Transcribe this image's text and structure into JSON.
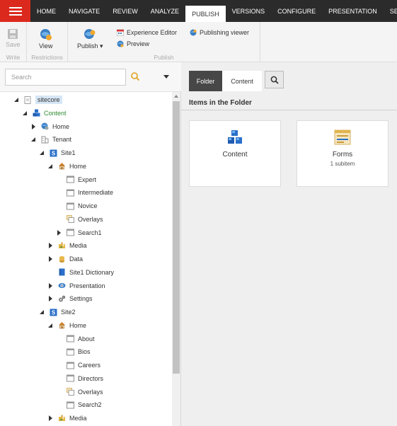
{
  "ribbon_tabs": [
    "HOME",
    "NAVIGATE",
    "REVIEW",
    "ANALYZE",
    "PUBLISH",
    "VERSIONS",
    "CONFIGURE",
    "PRESENTATION",
    "SECUR"
  ],
  "active_tab": "PUBLISH",
  "ribbon": {
    "write": {
      "group_label": "Write",
      "save_label": "Save"
    },
    "restrictions": {
      "group_label": "Restrictions",
      "view_label": "View"
    },
    "publish": {
      "group_label": "Publish",
      "publish_label": "Publish ▾",
      "experience_editor_label": "Experience Editor",
      "preview_label": "Preview",
      "publishing_viewer_label": "Publishing viewer"
    }
  },
  "search": {
    "placeholder": "Search",
    "value": ""
  },
  "tree": [
    {
      "label": "sitecore",
      "expander": "open",
      "icon": "sitecore-icon"
    },
    {
      "label": "Content",
      "expander": "open",
      "icon": "content-icon"
    },
    {
      "label": "Home",
      "expander": "closed",
      "icon": "globe-icon"
    },
    {
      "label": "Tenant",
      "expander": "open",
      "icon": "tenant-icon"
    },
    {
      "label": "Site1",
      "expander": "open",
      "icon": "site-icon"
    },
    {
      "label": "Home",
      "expander": "open",
      "icon": "house-icon"
    },
    {
      "label": "Expert",
      "expander": "none",
      "icon": "page-icon"
    },
    {
      "label": "Intermediate",
      "expander": "none",
      "icon": "page-icon"
    },
    {
      "label": "Novice",
      "expander": "none",
      "icon": "page-icon"
    },
    {
      "label": "Overlays",
      "expander": "none",
      "icon": "overlays-icon"
    },
    {
      "label": "Search1",
      "expander": "closed",
      "icon": "page-icon"
    },
    {
      "label": "Media",
      "expander": "closed",
      "icon": "media-icon"
    },
    {
      "label": "Data",
      "expander": "closed",
      "icon": "data-icon"
    },
    {
      "label": "Site1 Dictionary",
      "expander": "none",
      "icon": "dictionary-icon"
    },
    {
      "label": "Presentation",
      "expander": "closed",
      "icon": "presentation-icon"
    },
    {
      "label": "Settings",
      "expander": "closed",
      "icon": "settings-icon"
    },
    {
      "label": "Site2",
      "expander": "open",
      "icon": "site-icon"
    },
    {
      "label": "Home",
      "expander": "open",
      "icon": "house-icon"
    },
    {
      "label": "About",
      "expander": "none",
      "icon": "page-icon"
    },
    {
      "label": "Bios",
      "expander": "none",
      "icon": "page-icon"
    },
    {
      "label": "Careers",
      "expander": "none",
      "icon": "page-icon"
    },
    {
      "label": "Directors",
      "expander": "none",
      "icon": "page-icon"
    },
    {
      "label": "Overlays",
      "expander": "none",
      "icon": "overlays-icon"
    },
    {
      "label": "Search2",
      "expander": "none",
      "icon": "page-icon"
    },
    {
      "label": "Media",
      "expander": "closed",
      "icon": "media-icon"
    }
  ],
  "right": {
    "tabs": [
      "Folder",
      "Content"
    ],
    "active_tab": "Folder",
    "header": "Items in the Folder",
    "items": [
      {
        "title": "Content",
        "subtitle": "",
        "icon": "content-cubes-icon"
      },
      {
        "title": "Forms",
        "subtitle": "1 subitem",
        "icon": "forms-icon"
      }
    ]
  },
  "colors": {
    "accent_red": "#dc291e",
    "topbar": "#2b2b2b",
    "active_tab_dark": "#474747"
  }
}
